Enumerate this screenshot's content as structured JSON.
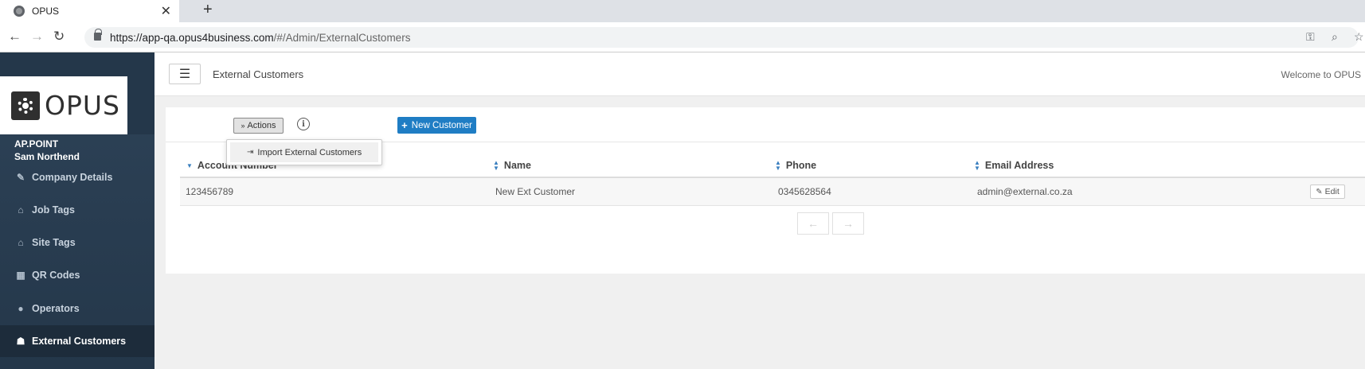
{
  "browser": {
    "tab_title": "OPUS",
    "tab_close": "✕",
    "new_tab": "+",
    "url_host": "https://app-qa.opus4business.com",
    "url_path": "/#/Admin/ExternalCustomers",
    "icons": [
      "globe-icon",
      "back-icon",
      "forward-icon",
      "reload-icon",
      "lock-icon",
      "key-icon",
      "zoom-icon",
      "star-icon"
    ]
  },
  "sidebar": {
    "logo_text": "OPUS",
    "company": "AP.POINT",
    "user": "Sam Northend",
    "items": [
      {
        "label": "Company Details",
        "icon": "✎",
        "active": false
      },
      {
        "label": "Job Tags",
        "icon": "⌂",
        "active": false
      },
      {
        "label": "Site Tags",
        "icon": "⌂",
        "active": false
      },
      {
        "label": "QR Codes",
        "icon": "▦",
        "active": false
      },
      {
        "label": "Operators",
        "icon": "●",
        "active": false
      },
      {
        "label": "External Customers",
        "icon": "☗",
        "active": true
      }
    ]
  },
  "header": {
    "hamburger": "☰",
    "title": "External Customers",
    "welcome": "Welcome to OPUS"
  },
  "toolbar": {
    "actions_label": "Actions",
    "actions_icon": "»",
    "info_icon": "i",
    "new_customer_label": "New Customer",
    "new_customer_icon": "+",
    "dropdown": {
      "import_label": "Import External Customers",
      "import_icon": "⇥"
    }
  },
  "table": {
    "columns": [
      "Account Number",
      "Name",
      "Phone",
      "Email Address"
    ],
    "rows": [
      {
        "account_number": "123456789",
        "name": "New Ext Customer",
        "phone": "0345628564",
        "email": "admin@external.co.za",
        "edit_label": "Edit"
      }
    ],
    "prev_icon": "←",
    "next_icon": "→"
  },
  "colors": {
    "sidebar_bg": "#2e4358",
    "primary_button": "#1f7dc4",
    "sort_arrow": "#3a7fbf"
  }
}
